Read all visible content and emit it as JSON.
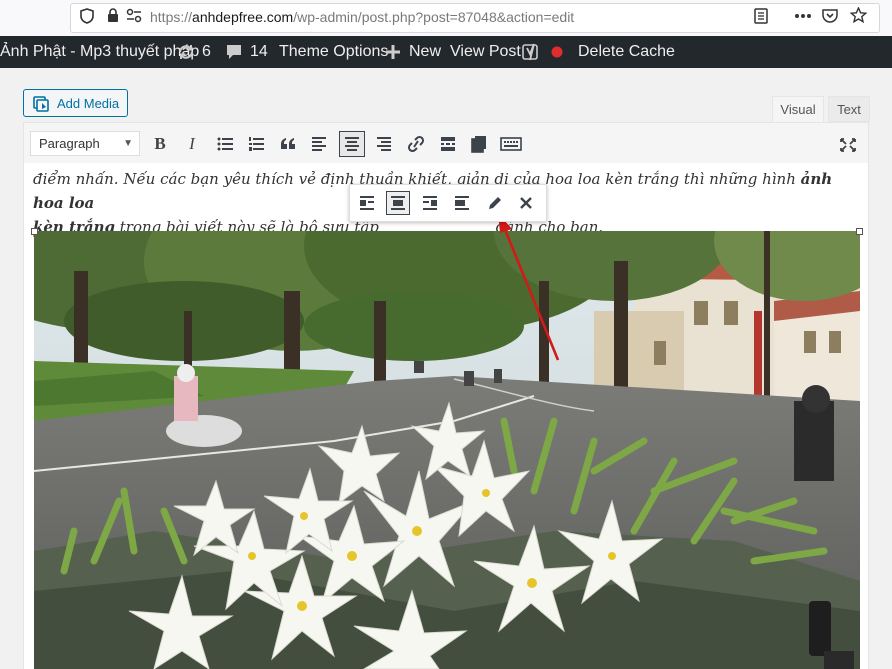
{
  "browser": {
    "url_prefix": "https://",
    "url_host": "anhdepfree.com",
    "url_path": "/wp-admin/post.php?post=87048&action=edit",
    "icons": [
      "shield-icon",
      "lock-icon",
      "permissions-icon",
      "reader-view-icon",
      "more-icon",
      "pocket-icon",
      "bookmark-star-icon"
    ]
  },
  "adminbar": {
    "site_name": "Ảnh Phật - Mp3 thuyết pháp",
    "updates_count": "6",
    "comments_count": "14",
    "theme_options": "Theme Options",
    "new_label": "New",
    "view_post": "View Post",
    "delete_cache": "Delete Cache",
    "colors": {
      "background": "#23282d",
      "status_dot": "#dd2d2d"
    }
  },
  "editor": {
    "add_media": "Add Media",
    "tab_visual": "Visual",
    "tab_text": "Text",
    "format_select": "Paragraph",
    "toolbar_icons": [
      "bold-icon",
      "italic-icon",
      "bulleted-list-icon",
      "numbered-list-icon",
      "blockquote-icon",
      "align-left-icon",
      "align-center-icon",
      "align-right-icon",
      "link-icon",
      "read-more-icon",
      "toolbar-toggle-icon",
      "keyboard-shortcuts-icon",
      "fullscreen-icon"
    ],
    "bold_label": "B",
    "italic_label": "I",
    "paragraph": {
      "line1_a": "điểm nhấn. Nếu các bạn yêu thích vẻ định thuần khiết, giản dị của hoa loa kèn trắng thì những hình ",
      "line1_bold": "ảnh hoa loa",
      "line2_bold": "kèn trắng",
      "line2_a": " trong bài viết này sẽ là bộ sưu tập",
      "line2_b": " dành cho bạn."
    },
    "image_toolbar_icons": [
      "align-left-icon",
      "align-center-icon",
      "align-right-icon",
      "align-none-icon",
      "edit-pencil-icon",
      "remove-icon"
    ],
    "accent_color": "#0071a1"
  }
}
